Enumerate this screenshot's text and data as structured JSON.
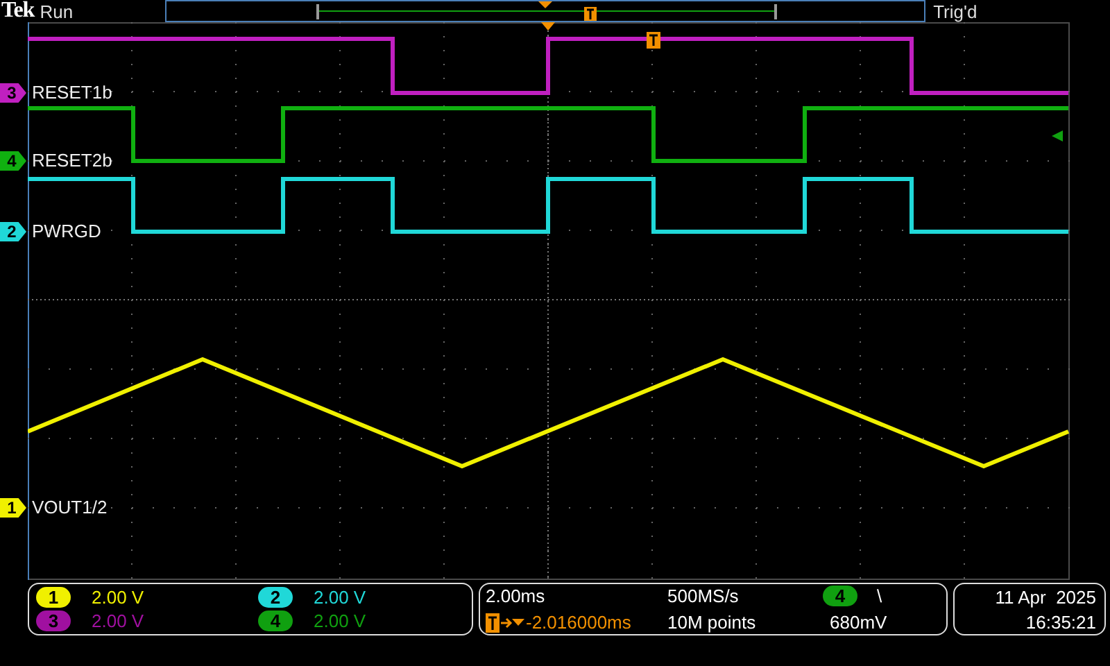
{
  "status": {
    "brand": "Tek",
    "acquisition": "Run",
    "trigger_state": "Trig'd"
  },
  "channels": [
    {
      "number": "3",
      "label": "RESET1b",
      "color": "#c020c0"
    },
    {
      "number": "4",
      "label": "RESET2b",
      "color": "#10b010"
    },
    {
      "number": "2",
      "label": "PWRGD",
      "color": "#20d8d8"
    },
    {
      "number": "1",
      "label": "VOUT1/2",
      "color": "#f0f000"
    }
  ],
  "vertical_scales": [
    {
      "number": "1",
      "scale": "2.00 V",
      "color": "#f0f000"
    },
    {
      "number": "2",
      "scale": "2.00 V",
      "color": "#20d8d8"
    },
    {
      "number": "3",
      "scale": "2.00 V",
      "color": "#a010a0"
    },
    {
      "number": "4",
      "scale": "2.00 V",
      "color": "#10a010"
    }
  ],
  "horizontal": {
    "time_per_div": "2.00ms",
    "delay": "-2.016000ms",
    "sample_rate": "500MS/s",
    "record_length": "10M points"
  },
  "trigger": {
    "source": "4",
    "slope": "\\",
    "level": "680mV",
    "color": "#10a010"
  },
  "datetime": {
    "date": "11 Apr  2025",
    "time": "16:35:21"
  }
}
